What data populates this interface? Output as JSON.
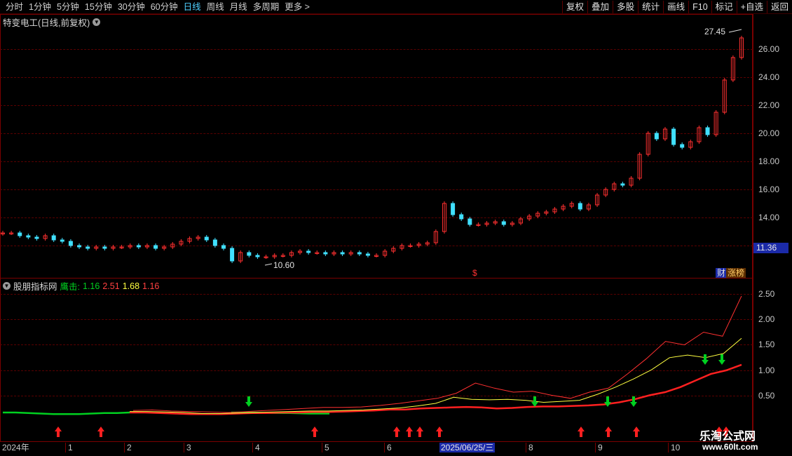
{
  "toolbar": {
    "tabs": [
      "分时",
      "1分钟",
      "5分钟",
      "15分钟",
      "30分钟",
      "60分钟",
      "日线",
      "周线",
      "月线",
      "多周期",
      "更多 >"
    ],
    "active_tab": "日线",
    "right_buttons": [
      "复权",
      "叠加",
      "多股",
      "统计",
      "画线",
      "F10",
      "标记",
      "+自选",
      "返回"
    ]
  },
  "main_chart": {
    "title": "特变电工(日线,前复权)",
    "current_price": "11.36",
    "high_label": "27.45",
    "low_label": "10.60",
    "badges": [
      "财",
      "涨榜"
    ],
    "dollar_marker": "$"
  },
  "indicator": {
    "name": "股朋指标网",
    "legend_label": "鹰击:",
    "v1": "1.16",
    "v2": "2.51",
    "v3": "1.68",
    "v4": "1.16"
  },
  "colors": {
    "up": "#ff3030",
    "down": "#40e0ff",
    "green_line": "#00d020",
    "yellow_line": "#ffff40",
    "grid": "#5a0000"
  },
  "chart_data": [
    {
      "type": "candlestick",
      "y_ticks": [
        "26.00",
        "24.00",
        "22.00",
        "20.00",
        "18.00",
        "16.00",
        "14.00"
      ],
      "ylim": [
        10.0,
        28.0
      ],
      "x_period": "2024-2025 daily",
      "closes": [
        12.9,
        12.9,
        12.7,
        12.6,
        12.5,
        12.7,
        12.4,
        12.3,
        12.0,
        11.9,
        11.8,
        11.9,
        11.8,
        11.9,
        11.9,
        12.0,
        11.9,
        12.0,
        11.8,
        11.9,
        12.1,
        12.3,
        12.5,
        12.6,
        12.4,
        12.0,
        11.8,
        10.9,
        11.5,
        11.3,
        11.2,
        11.2,
        11.3,
        11.3,
        11.5,
        11.6,
        11.5,
        11.5,
        11.4,
        11.5,
        11.4,
        11.5,
        11.4,
        11.3,
        11.3,
        11.6,
        11.8,
        12.0,
        12.0,
        12.1,
        12.2,
        13.0,
        15.0,
        14.2,
        13.9,
        13.5,
        13.5,
        13.6,
        13.7,
        13.5,
        13.6,
        13.9,
        14.1,
        14.3,
        14.4,
        14.6,
        14.8,
        15.0,
        14.6,
        14.9,
        15.6,
        16.0,
        16.4,
        16.3,
        16.8,
        18.5,
        20.0,
        19.6,
        20.3,
        19.2,
        19.0,
        19.4,
        20.4,
        19.9,
        21.5,
        23.8,
        25.4,
        26.8
      ],
      "series": [
        {
          "values_from": "closes"
        }
      ]
    },
    {
      "type": "line",
      "y_ticks": [
        "2.50",
        "2.00",
        "1.50",
        "1.00",
        "0.50"
      ],
      "ylim": [
        0.0,
        2.7
      ],
      "series": [
        {
          "name": "",
          "color": "red/green",
          "values": [
            0.22,
            0.22,
            0.21,
            0.2,
            0.19,
            0.19,
            0.19,
            0.2,
            0.21,
            0.21,
            0.22,
            0.22,
            0.23,
            0.23,
            0.24,
            0.25,
            0.26,
            0.28,
            0.28,
            0.3,
            0.31,
            0.32,
            0.33,
            0.32,
            0.3,
            0.31,
            0.33,
            0.34,
            0.34,
            0.35,
            0.36,
            0.38,
            0.42,
            0.48,
            0.56,
            0.62,
            0.72,
            0.85,
            0.98,
            1.05,
            1.16
          ]
        },
        {
          "name": "",
          "color": "yellow",
          "values": [
            0.24,
            0.24,
            0.23,
            0.22,
            0.2,
            0.2,
            0.21,
            0.22,
            0.23,
            0.24,
            0.25,
            0.25,
            0.26,
            0.27,
            0.29,
            0.31,
            0.35,
            0.4,
            0.52,
            0.48,
            0.47,
            0.48,
            0.46,
            0.42,
            0.44,
            0.46,
            0.58,
            0.72,
            0.88,
            1.06,
            1.3,
            1.35,
            1.3,
            1.38,
            1.68
          ]
        },
        {
          "name": "",
          "color": "red-thin",
          "values": [
            0.26,
            0.27,
            0.25,
            0.24,
            0.23,
            0.22,
            0.24,
            0.26,
            0.28,
            0.3,
            0.32,
            0.32,
            0.33,
            0.36,
            0.4,
            0.45,
            0.5,
            0.6,
            0.8,
            0.7,
            0.62,
            0.64,
            0.56,
            0.5,
            0.62,
            0.7,
            0.98,
            1.28,
            1.62,
            1.55,
            1.8,
            1.72,
            2.51
          ]
        }
      ]
    }
  ],
  "x_axis": {
    "labels": [
      "2024年",
      "1",
      "2",
      "3",
      "4",
      "5",
      "6",
      "2025/06/25/三",
      "8",
      "9",
      "10"
    ]
  },
  "watermark": {
    "line1": "乐淘公式网",
    "line2": "www.60lt.com"
  }
}
